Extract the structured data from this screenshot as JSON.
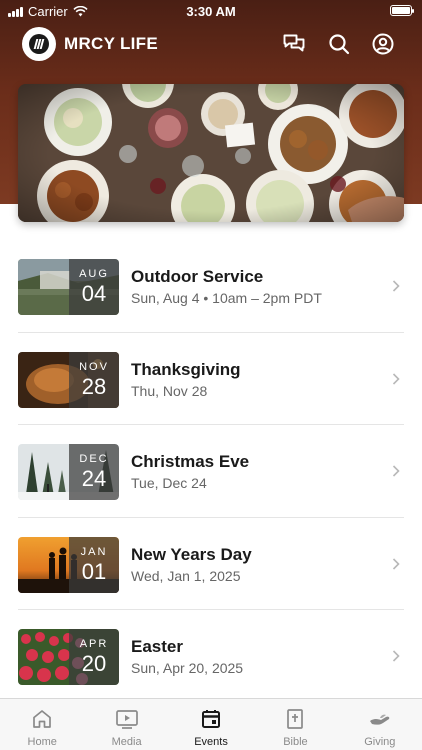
{
  "status_bar": {
    "carrier": "Carrier",
    "time": "3:30 AM"
  },
  "header": {
    "app_name": "MRCY LIFE"
  },
  "events": [
    {
      "title": "Outdoor Service",
      "subtitle": "Sun, Aug 4 • 10am – 2pm PDT",
      "month": "AUG",
      "day": "04",
      "thumb_colors": [
        "#4a5a3a",
        "#7c8a6a"
      ]
    },
    {
      "title": "Thanksgiving",
      "subtitle": "Thu, Nov 28",
      "month": "NOV",
      "day": "28",
      "thumb_colors": [
        "#6a3a1a",
        "#b5733a"
      ]
    },
    {
      "title": "Christmas Eve",
      "subtitle": "Tue, Dec 24",
      "month": "DEC",
      "day": "24",
      "thumb_colors": [
        "#3a4a3a",
        "#e8ecee"
      ]
    },
    {
      "title": "New Years Day",
      "subtitle": "Wed, Jan 1, 2025",
      "month": "JAN",
      "day": "01",
      "thumb_colors": [
        "#e08a2a",
        "#2a1a10"
      ]
    },
    {
      "title": "Easter",
      "subtitle": "Sun, Apr 20, 2025",
      "month": "APR",
      "day": "20",
      "thumb_colors": [
        "#c0304a",
        "#e87a8a"
      ]
    }
  ],
  "tabs": [
    {
      "label": "Home",
      "icon": "home-icon",
      "active": false
    },
    {
      "label": "Media",
      "icon": "media-icon",
      "active": false
    },
    {
      "label": "Events",
      "icon": "calendar-icon",
      "active": true
    },
    {
      "label": "Bible",
      "icon": "bible-icon",
      "active": false
    },
    {
      "label": "Giving",
      "icon": "giving-icon",
      "active": false
    }
  ],
  "colors": {
    "header_brown": "#6b2d1a",
    "active_tab": "#1a1a1a",
    "inactive_tab": "#8a8a8a"
  }
}
